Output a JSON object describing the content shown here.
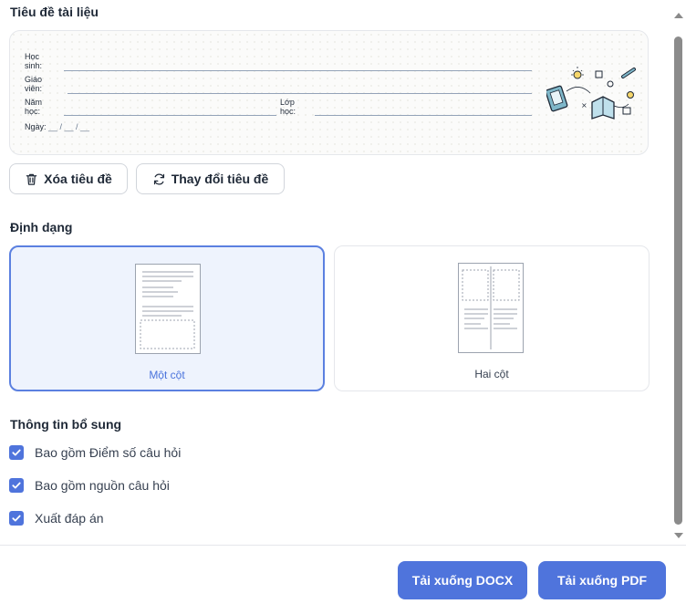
{
  "header_section": {
    "title": "Tiêu đề tài liệu",
    "fields": {
      "hoc_sinh": "Học sinh:",
      "giao_vien": "Giáo viên:",
      "nam_hoc": "Năm học:",
      "lop_hoc": "Lớp học:",
      "ngay": "Ngày:",
      "date_blank": "__ / __ / __"
    },
    "delete_button": "Xóa tiêu đề",
    "change_button": "Thay đổi tiêu đề"
  },
  "format_section": {
    "title": "Định dạng",
    "options": [
      {
        "label": "Một cột",
        "selected": true
      },
      {
        "label": "Hai cột",
        "selected": false
      }
    ]
  },
  "extra_section": {
    "title": "Thông tin bổ sung",
    "checkboxes": [
      {
        "label": "Bao gồm Điểm số câu hỏi",
        "checked": true
      },
      {
        "label": "Bao gồm nguồn câu hỏi",
        "checked": true
      },
      {
        "label": "Xuất đáp án",
        "checked": true
      }
    ]
  },
  "footer": {
    "docx_button": "Tải xuống DOCX",
    "pdf_button": "Tải xuống PDF"
  },
  "colors": {
    "accent": "#4f74dc",
    "selected_bg": "#eef3fd",
    "selected_border": "#5b80e0"
  },
  "icons": {
    "delete": "trash-icon",
    "change": "refresh-icon",
    "check": "checkmark-icon"
  }
}
